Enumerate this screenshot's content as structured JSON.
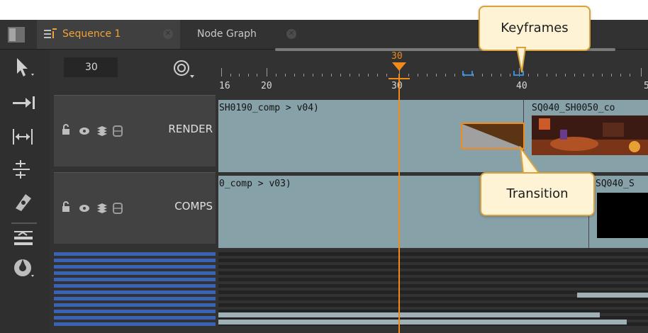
{
  "tabs": {
    "active": {
      "label": "Sequence 1",
      "close": "✕"
    },
    "inactive": {
      "label": "Node Graph",
      "close": "✕"
    }
  },
  "toolbar": {
    "tools": [
      "select-tool",
      "track-forward-tool",
      "slip-tool",
      "ripple-tool",
      "razor-tool",
      "track-stack-tool",
      "multi-tool"
    ]
  },
  "viewer": {
    "frame": "30",
    "playhead_frame": "30"
  },
  "ruler": {
    "labels": [
      "16",
      "20",
      "30",
      "40",
      "5"
    ]
  },
  "tracks": [
    {
      "name": "RENDER",
      "clip_left": "SH0190_comp > v04)",
      "clip_right": "SQ040_SH0050_co"
    },
    {
      "name": "COMPS",
      "clip_left": "0_comp > v03)",
      "clip_right": "SQ040_S"
    }
  ],
  "callouts": {
    "keyframes": "Keyframes",
    "transition": "Transition"
  },
  "colors": {
    "accent": "#f08a1a",
    "lane": "#87a1a9",
    "keyframe": "#3b8ed6",
    "mini_track": "#3a63b6"
  }
}
